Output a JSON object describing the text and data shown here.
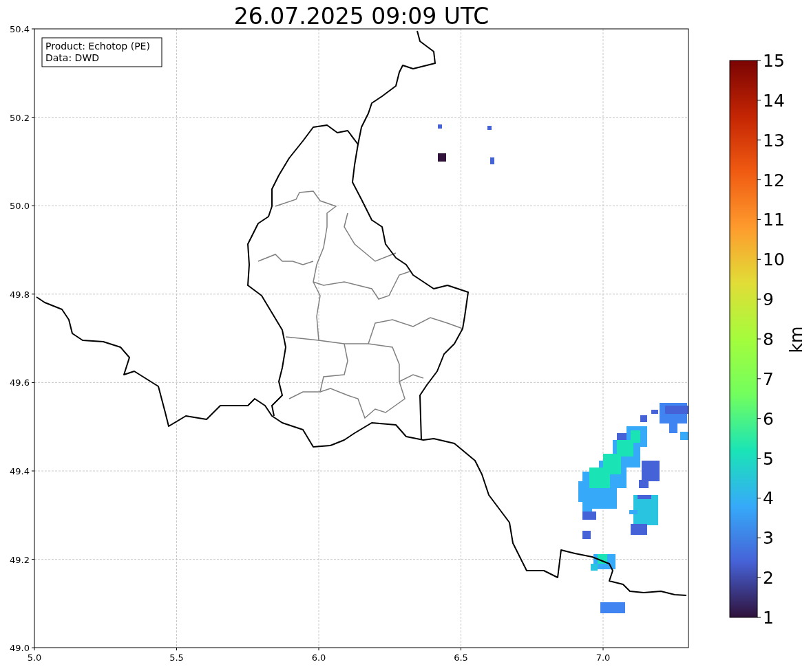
{
  "title": "26.07.2025 09:09 UTC",
  "info_box": [
    "Product: Echotop (PE)",
    "Data: DWD"
  ],
  "map": {
    "xticks": [
      "5.0",
      "5.5",
      "6.0",
      "6.5",
      "7.0"
    ],
    "yticks": [
      "50.4",
      "50.2",
      "50.0",
      "49.8",
      "49.6",
      "49.4",
      "49.2",
      "49.0"
    ]
  },
  "colorbar": {
    "label": "km",
    "ticks": [
      "15",
      "14",
      "13",
      "12",
      "11",
      "10",
      "9",
      "8",
      "7",
      "6",
      "5",
      "4",
      "3",
      "2",
      "1"
    ]
  }
}
